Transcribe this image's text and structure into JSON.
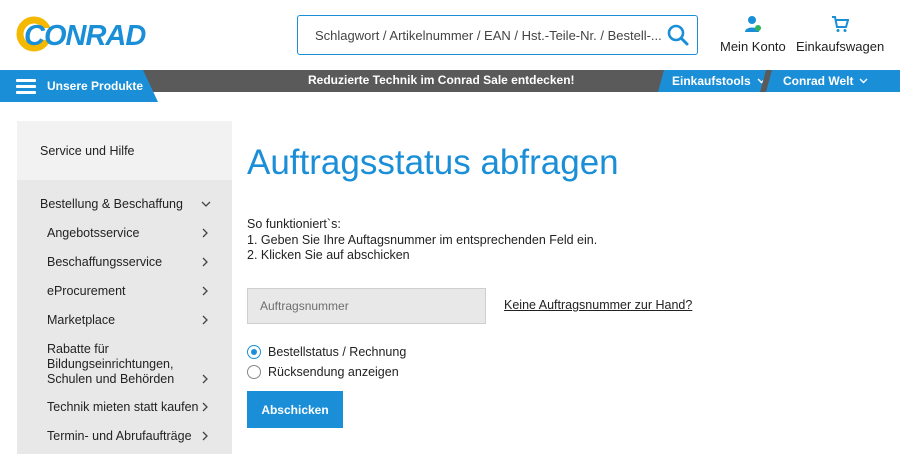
{
  "header": {
    "logo_text": "CONRAD",
    "search_placeholder": "Schlagwort / Artikelnummer / EAN / Hst.-Teile-Nr. / Bestell-...",
    "account_label": "Mein Konto",
    "cart_label": "Einkaufswagen",
    "icons": {
      "search": "search-icon",
      "account": "user-icon",
      "cart": "cart-icon"
    }
  },
  "nav": {
    "products_label": "Unsere Produkte",
    "promo_text": "Reduzierte Technik im Conrad Sale entdecken!",
    "tools_label": "Einkaufstools",
    "world_label": "Conrad Welt"
  },
  "sidebar": {
    "service_label": "Service und Hilfe",
    "section_label": "Bestellung & Beschaffung",
    "items": [
      {
        "label": "Angebotsservice"
      },
      {
        "label": "Beschaffungsservice"
      },
      {
        "label": "eProcurement"
      },
      {
        "label": "Marketplace"
      },
      {
        "label": "Rabatte für Bildungseinrichtungen, Schulen und Behörden"
      },
      {
        "label": "Technik mieten statt kaufen"
      },
      {
        "label": "Termin- und Abrufaufträge"
      }
    ]
  },
  "main": {
    "title": "Auftragsstatus abfragen",
    "howto_heading": "So funktioniert`s:",
    "howto_step1": "1. Geben Sie Ihre Auftagsnummer im entsprechenden Feld ein.",
    "howto_step2": "2. Klicken Sie auf abschicken",
    "order_placeholder": "Auftragsnummer",
    "no_number_link": "Keine Auftragsnummer zur Hand?",
    "radio_status": "Bestellstatus / Rechnung",
    "radio_return": "Rücksendung anzeigen",
    "selected_option": "Bestellstatus / Rechnung",
    "submit_label": "Abschicken"
  },
  "colors": {
    "brand_blue": "#1a8fd8",
    "logo_yellow": "#f5b800",
    "nav_gray": "#5a5a5a",
    "sidebar_gray": "#e8e8e8",
    "input_gray": "#e8e8e8"
  }
}
